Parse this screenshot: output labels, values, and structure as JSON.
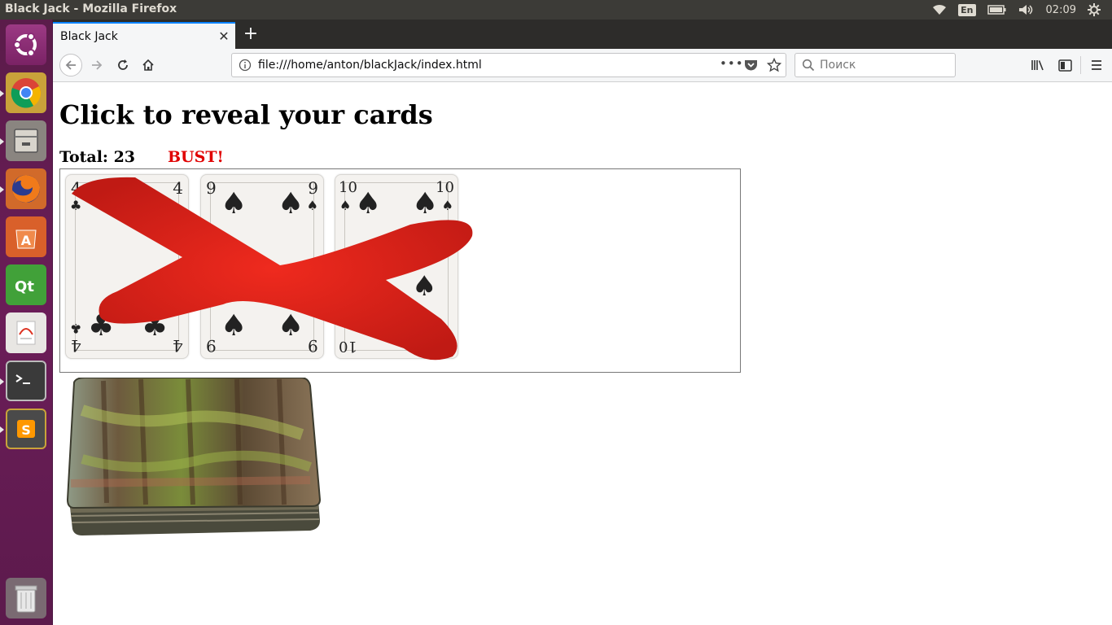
{
  "system": {
    "window_title": "Black Jack - Mozilla Firefox",
    "keyboard_layout": "En",
    "clock": "02:09"
  },
  "launcher": {
    "items": [
      {
        "name": "ubuntu-dash",
        "icon": "ubuntu-logo-icon"
      },
      {
        "name": "chrome",
        "icon": "chrome-icon"
      },
      {
        "name": "files",
        "icon": "file-cabinet-icon"
      },
      {
        "name": "firefox",
        "icon": "firefox-icon"
      },
      {
        "name": "software",
        "icon": "software-center-icon"
      },
      {
        "name": "qt-creator",
        "icon": "qt-icon"
      },
      {
        "name": "document-viewer",
        "icon": "document-viewer-icon"
      },
      {
        "name": "terminal",
        "icon": "terminal-icon"
      },
      {
        "name": "sublime-text",
        "icon": "sublime-icon"
      },
      {
        "name": "trash",
        "icon": "trash-icon"
      }
    ]
  },
  "browser": {
    "tab_title": "Black Jack",
    "url": "file:///home/anton/blackJack/index.html",
    "search_placeholder": "Поиск",
    "page_actions_label": "•••"
  },
  "page": {
    "heading": "Click to reveal your cards",
    "total_label": "Total: 23",
    "status": "BUST!",
    "status_color": "#e00000",
    "cards": [
      {
        "rank": "4",
        "suit": "clubs",
        "symbol": "♣"
      },
      {
        "rank": "9",
        "suit": "spades",
        "symbol": "♠"
      },
      {
        "rank": "10",
        "suit": "spades",
        "symbol": "♠"
      }
    ],
    "bust_mark": "red-x-icon",
    "deck_image": "card-deck-icon"
  }
}
